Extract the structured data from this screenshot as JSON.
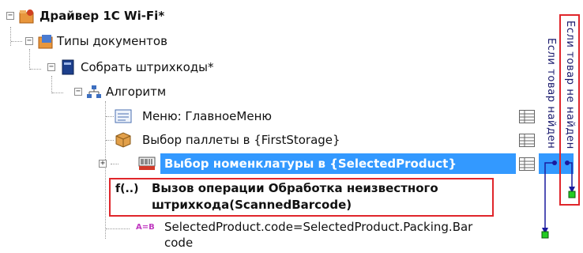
{
  "tree": {
    "root": {
      "label": "Драйвер 1С Wi-Fi*",
      "icon": "gear-folder-icon"
    },
    "doc_types": {
      "label": "Типы документов",
      "icon": "folder-documents-icon"
    },
    "collect": {
      "label": "Собрать штрихкоды*",
      "icon": "book-icon"
    },
    "algorithm": {
      "label": "Алгоритм",
      "icon": "hierarchy-icon"
    },
    "steps": [
      {
        "label": "Меню: ГлавноеМеню",
        "icon": "menu-icon"
      },
      {
        "label": "Выбор паллеты в {FirstStorage}",
        "icon": "box-icon"
      },
      {
        "label": "Выбор номенклатуры в {SelectedProduct}",
        "icon": "barcode-scanner-icon",
        "selected": true
      },
      {
        "label_line1": "Вызов операции Обработка неизвестного",
        "label_line2": "штрихкода(ScannedBarcode)",
        "icon": "function-icon",
        "icon_text": "f(..)"
      },
      {
        "label_line1": "SelectedProduct.code=SelectedProduct.Packing.Bar",
        "label_line2": "code",
        "icon": "assignment-icon",
        "icon_text": "A=B"
      }
    ]
  },
  "transitions": {
    "outer": "Если товар не найден",
    "inner": "Если товар найден"
  },
  "colors": {
    "selection": "#3399ff",
    "highlight_frame": "#e0262b",
    "arrow": "#1a1a9e",
    "node_green": "#22cc22"
  }
}
